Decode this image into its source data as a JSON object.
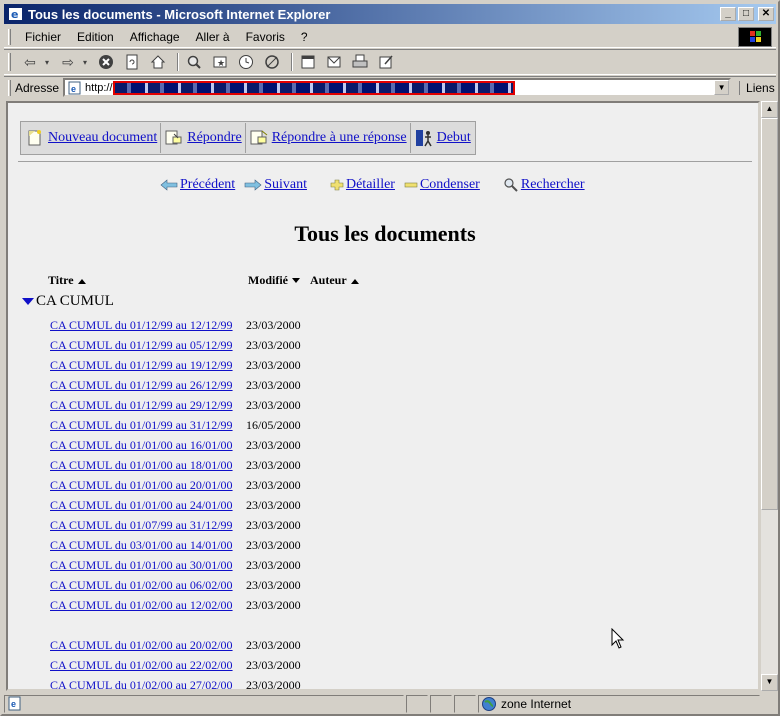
{
  "window": {
    "title": "Tous les documents - Microsoft Internet Explorer"
  },
  "menu": [
    {
      "label": "Fichier"
    },
    {
      "label": "Edition"
    },
    {
      "label": "Affichage"
    },
    {
      "label": "Aller à"
    },
    {
      "label": "Favoris"
    },
    {
      "label": "?"
    }
  ],
  "toolbar": {
    "icons": [
      "back-icon",
      "forward-icon",
      "stop-icon",
      "refresh-icon",
      "home-icon",
      "search-icon",
      "favorites-icon",
      "history-icon",
      "channels-icon",
      "fullscreen-icon",
      "mail-icon",
      "print-icon",
      "edit-icon"
    ]
  },
  "address": {
    "label": "Adresse",
    "url_prefix": "http://",
    "links_label": "Liens"
  },
  "actions": [
    {
      "label": "Nouveau document",
      "icon": "new-document-icon"
    },
    {
      "label": "Répondre",
      "icon": "reply-icon"
    },
    {
      "label": "Répondre à une réponse",
      "icon": "reply-to-reply-icon"
    },
    {
      "label": "Debut",
      "icon": "home-start-icon"
    }
  ],
  "nav": {
    "previous": "Précédent",
    "next": "Suivant",
    "expand": "Détailler",
    "collapse": "Condenser",
    "search": "Rechercher"
  },
  "page": {
    "title": "Tous les documents"
  },
  "columns": {
    "title": "Titre",
    "modified": "Modifié",
    "author": "Auteur"
  },
  "category": {
    "name": "CA CUMUL"
  },
  "documents": [
    {
      "title": "CA CUMUL du 01/12/99 au 12/12/99",
      "date": "23/03/2000"
    },
    {
      "title": "CA CUMUL du 01/12/99 au 05/12/99",
      "date": "23/03/2000"
    },
    {
      "title": "CA CUMUL du 01/12/99 au 19/12/99",
      "date": "23/03/2000"
    },
    {
      "title": "CA CUMUL du 01/12/99 au 26/12/99",
      "date": "23/03/2000"
    },
    {
      "title": "CA CUMUL du 01/12/99 au 29/12/99",
      "date": "23/03/2000"
    },
    {
      "title": "CA CUMUL du 01/01/99 au 31/12/99",
      "date": "16/05/2000"
    },
    {
      "title": "CA CUMUL du 01/01/00 au 16/01/00",
      "date": "23/03/2000"
    },
    {
      "title": "CA CUMUL du 01/01/00 au 18/01/00",
      "date": "23/03/2000"
    },
    {
      "title": "CA CUMUL du 01/01/00 au 20/01/00",
      "date": "23/03/2000"
    },
    {
      "title": "CA CUMUL du 01/01/00 au 24/01/00",
      "date": "23/03/2000"
    },
    {
      "title": "CA CUMUL du 01/07/99 au 31/12/99",
      "date": "23/03/2000"
    },
    {
      "title": "CA CUMUL du 03/01/00 au 14/01/00",
      "date": "23/03/2000"
    },
    {
      "title": "CA CUMUL du 01/01/00 au 30/01/00",
      "date": "23/03/2000"
    },
    {
      "title": "CA CUMUL du 01/02/00 au 06/02/00",
      "date": "23/03/2000"
    },
    {
      "title": "CA CUMUL du 01/02/00 au 12/02/00",
      "date": "23/03/2000"
    },
    {
      "title": "",
      "date": ""
    },
    {
      "title": "CA CUMUL du 01/02/00 au 20/02/00",
      "date": "23/03/2000"
    },
    {
      "title": "CA CUMUL du 01/02/00 au 22/02/00",
      "date": "23/03/2000"
    },
    {
      "title": "CA CUMUL du 01/02/00 au 27/02/00",
      "date": "23/03/2000"
    }
  ],
  "status": {
    "zone": "zone Internet"
  }
}
